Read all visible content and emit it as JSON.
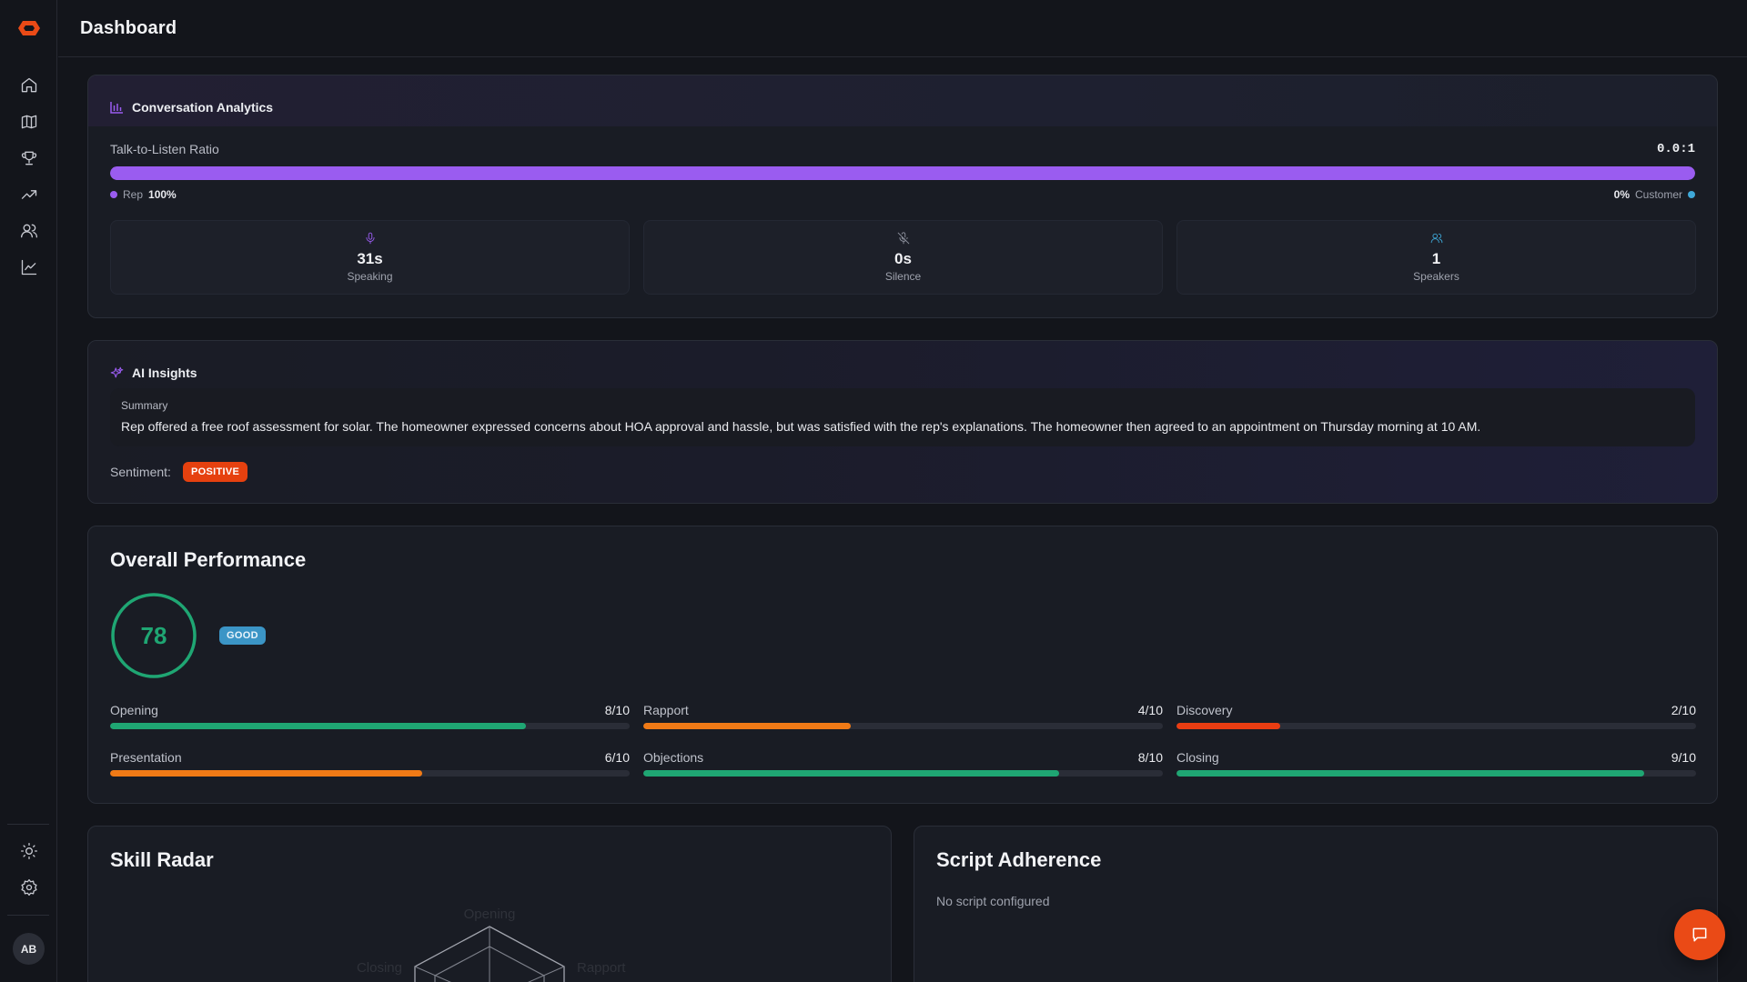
{
  "header": {
    "title": "Dashboard"
  },
  "sidebar": {
    "avatar_initials": "AB",
    "nav": [
      {
        "icon": "home-icon"
      },
      {
        "icon": "map-icon"
      },
      {
        "icon": "trophy-icon"
      },
      {
        "icon": "trending-up-icon"
      },
      {
        "icon": "users-icon"
      },
      {
        "icon": "line-chart-icon"
      }
    ],
    "bottom": [
      {
        "icon": "sun-icon"
      },
      {
        "icon": "gear-icon"
      }
    ]
  },
  "analytics": {
    "title": "Conversation Analytics",
    "ratio_label": "Talk-to-Listen Ratio",
    "ratio_value": "0.0:1",
    "rep_share": 100,
    "rep_label": "Rep",
    "rep_percent": "100%",
    "customer_label": "Customer",
    "customer_percent": "0%",
    "stats": [
      {
        "value": "31s",
        "label": "Speaking",
        "icon": "microphone-icon"
      },
      {
        "value": "0s",
        "label": "Silence",
        "icon": "mic-off-icon"
      },
      {
        "value": "1",
        "label": "Speakers",
        "icon": "users-icon"
      }
    ],
    "colors": {
      "rep": "#9a5cf0",
      "customer": "#3ea8d8"
    }
  },
  "insights": {
    "title": "AI Insights",
    "summary_label": "Summary",
    "summary_text": "Rep offered a free roof assessment for solar. The homeowner expressed concerns about HOA approval and hassle, but was satisfied with the rep's explanations. The homeowner then agreed to an appointment on Thursday morning at 10 AM.",
    "sentiment_label": "Sentiment:",
    "sentiment_value": "POSITIVE"
  },
  "performance": {
    "title": "Overall Performance",
    "score": "78",
    "score_fraction": 0.78,
    "grade": "GOOD",
    "metrics": [
      {
        "name": "Opening",
        "score": "8/10",
        "value": 8,
        "color": "#1fa673"
      },
      {
        "name": "Rapport",
        "score": "4/10",
        "value": 4,
        "color": "#f07a16"
      },
      {
        "name": "Discovery",
        "score": "2/10",
        "value": 2,
        "color": "#ea3d12"
      },
      {
        "name": "Presentation",
        "score": "6/10",
        "value": 6,
        "color": "#f07a16"
      },
      {
        "name": "Objections",
        "score": "8/10",
        "value": 8,
        "color": "#1fa673"
      },
      {
        "name": "Closing",
        "score": "9/10",
        "value": 9,
        "color": "#1fa673"
      }
    ]
  },
  "radar": {
    "title": "Skill Radar",
    "axis_labels": [
      "Opening",
      "Rapport",
      "Closing"
    ]
  },
  "script": {
    "title": "Script Adherence",
    "empty_text": "No script configured"
  }
}
